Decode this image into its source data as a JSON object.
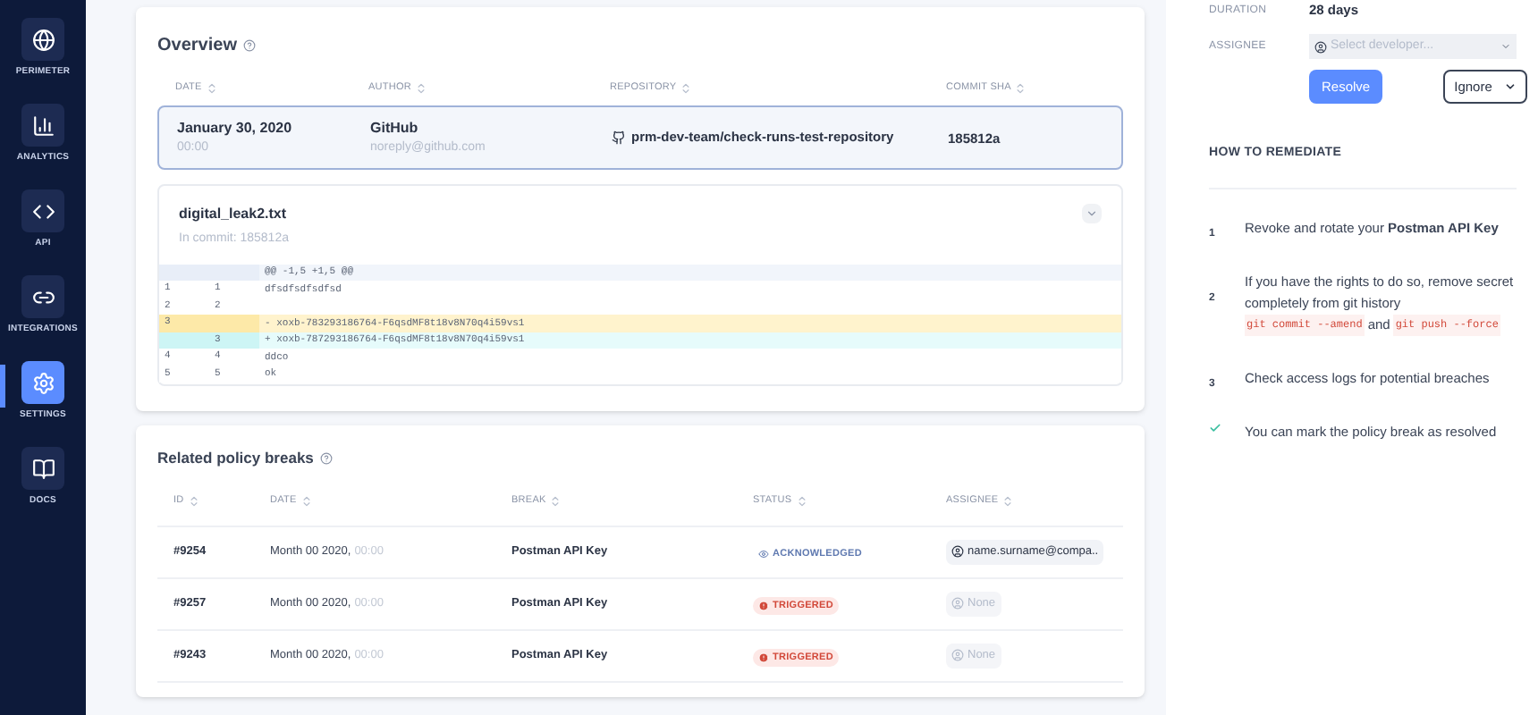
{
  "sidebar": {
    "items": [
      {
        "label": "PERIMETER",
        "selected": false
      },
      {
        "label": "ANALYTICS",
        "selected": false
      },
      {
        "label": "API",
        "selected": false
      },
      {
        "label": "INTEGRATIONS",
        "selected": false
      },
      {
        "label": "SETTINGS",
        "selected": true
      },
      {
        "label": "DOCS",
        "selected": false
      }
    ]
  },
  "overview": {
    "title": "Overview",
    "columns": [
      "DATE",
      "AUTHOR",
      "REPOSITORY",
      "COMMIT SHA"
    ],
    "commit": {
      "date": "January 30, 2020",
      "time": "00:00",
      "author": "GitHub",
      "email": "noreply@github.com",
      "repository": "prm-dev-team/check-runs-test-repository",
      "sha": "185812a",
      "selected": true
    },
    "file": {
      "name": "digital_leak2.txt",
      "commit": "In commit: 185812a",
      "expanded": true,
      "lines": [
        {
          "kind": "hunk",
          "text": "@@ -1,5 +1,5 @@"
        },
        {
          "kind": "context",
          "old": "1",
          "new": "1",
          "text": "dfsdfsdfsdfsd"
        },
        {
          "kind": "context",
          "old": "2",
          "new": "2"
        },
        {
          "kind": "removed",
          "old": "3",
          "text": "- xoxb-783293186764-F6qsdMF8t18v8N70q4i59vs1"
        },
        {
          "kind": "added",
          "new": "3",
          "text": "+ xoxb-787293186764-F6qsdMF8t18v8N70q4i59vs1"
        },
        {
          "kind": "context",
          "old": "4",
          "new": "4",
          "text": "ddco"
        },
        {
          "kind": "context",
          "old": "5",
          "new": "5",
          "text": "ok"
        }
      ]
    }
  },
  "related": {
    "title": "Related policy breaks",
    "columns": [
      "ID",
      "DATE",
      "BREAK",
      "STATUS",
      "ASSIGNEE"
    ],
    "rows": [
      {
        "id": "#9254",
        "date": "Month 00 2020,",
        "time": "00:00",
        "break": "Postman API Key",
        "status": {
          "kind": "acknowledged",
          "label": "ACKNOWLEDGED"
        },
        "assignee": {
          "kind": "user",
          "name": "name.surname@compa.."
        }
      },
      {
        "id": "#9257",
        "date": "Month 00 2020,",
        "time": "00:00",
        "break": "Postman API Key",
        "status": {
          "kind": "triggered",
          "label": "TRIGGERED"
        },
        "assignee": {
          "kind": "none",
          "name": "None"
        }
      },
      {
        "id": "#9243",
        "date": "Month 00 2020,",
        "time": "00:00",
        "break": "Postman API Key",
        "status": {
          "kind": "triggered",
          "label": "TRIGGERED"
        },
        "assignee": {
          "kind": "none",
          "name": "None"
        }
      }
    ]
  },
  "details": {
    "duration_label": "DURATION",
    "duration": "28 days",
    "assignee_label": "ASSIGNEE",
    "assignee_placeholder": "Select developer...",
    "resolve": "Resolve",
    "ignore": "Ignore"
  },
  "remediate": {
    "title": "HOW TO REMEDIATE",
    "steps": [
      {
        "kind": "number",
        "marker": "1",
        "parts": [
          {
            "kind": "text",
            "text": "Revoke and rotate your **Postman API Key**"
          }
        ]
      },
      {
        "kind": "number",
        "marker": "2",
        "parts": [
          {
            "kind": "text",
            "text": "If you have the rights to do so, remove secret completely from git history"
          },
          {
            "kind": "code",
            "text": "git commit --amend"
          },
          {
            "kind": "inline",
            "text": "and"
          },
          {
            "kind": "code",
            "text": "git push --force"
          }
        ]
      },
      {
        "kind": "number",
        "marker": "3",
        "parts": [
          {
            "kind": "text",
            "text": "Check access logs for potential breaches"
          }
        ]
      },
      {
        "kind": "check",
        "parts": [
          {
            "kind": "text",
            "text": "You can mark the policy break as resolved"
          }
        ]
      }
    ]
  }
}
